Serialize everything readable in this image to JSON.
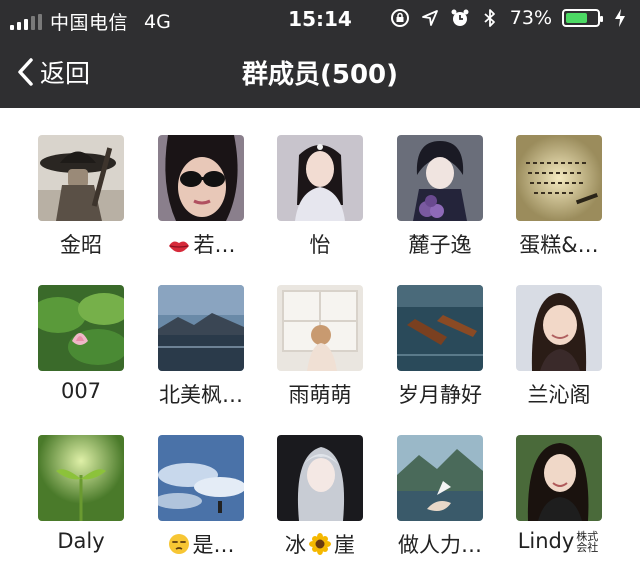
{
  "status_bar": {
    "carrier": "中国电信",
    "network": "4G",
    "time": "15:14",
    "battery_percent": "73%",
    "battery_level": 0.73,
    "icons": [
      "rotation-lock-icon",
      "location-icon",
      "alarm-icon",
      "bluetooth-icon",
      "charging-icon"
    ]
  },
  "nav": {
    "back_label": "返回",
    "title": "群成员(500)"
  },
  "members": [
    {
      "name": "金昭",
      "avatar": "hat-man-photo"
    },
    {
      "name": "若…",
      "avatar": "sunglasses-woman-photo",
      "prefix_icon": "lips-emoji-icon"
    },
    {
      "name": "怡",
      "avatar": "girl-white-dress-photo"
    },
    {
      "name": "麓子逸",
      "avatar": "anime-boy-flowers-photo"
    },
    {
      "name": "蛋糕&…",
      "avatar": "handwritten-note-photo"
    },
    {
      "name": "007",
      "avatar": "lotus-photo"
    },
    {
      "name": "北美枫…",
      "avatar": "lake-mountain-photo"
    },
    {
      "name": "雨萌萌",
      "avatar": "child-window-photo"
    },
    {
      "name": "岁月静好",
      "avatar": "boats-photo"
    },
    {
      "name": "兰沁阁",
      "avatar": "smiling-woman-photo"
    },
    {
      "name": "Daly",
      "avatar": "sprout-photo"
    },
    {
      "name": "是…",
      "avatar": "sky-clouds-photo",
      "prefix_icon": "unamused-emoji-icon"
    },
    {
      "name": "崖",
      "avatar": "silver-hair-photo",
      "prefix_text": "冰",
      "prefix_icon": "sunflower-emoji-icon"
    },
    {
      "name": "做人力…",
      "avatar": "bird-hand-photo"
    },
    {
      "name": "Lindy",
      "avatar": "long-hair-woman-photo",
      "suffix_tag": "株式会社"
    }
  ]
}
